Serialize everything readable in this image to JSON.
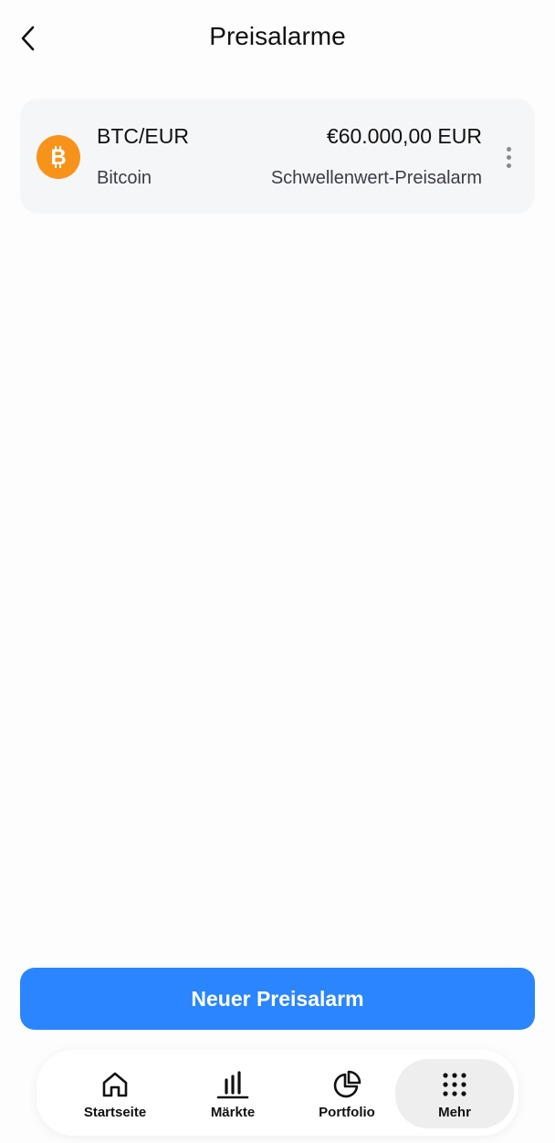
{
  "header": {
    "title": "Preisalarme",
    "back_icon": "chevron-left-icon"
  },
  "alarms": [
    {
      "pair": "BTC/EUR",
      "coin_name": "Bitcoin",
      "price": "€60.000,00 EUR",
      "type": "Schwellenwert-Preisalarm",
      "coin_color": "#f7931a",
      "icon": "bitcoin-icon",
      "more_icon": "more-vertical-icon"
    }
  ],
  "primary_button": {
    "label": "Neuer Preisalarm",
    "color": "#2a85ff"
  },
  "bottom_nav": {
    "items": [
      {
        "label": "Startseite",
        "icon": "home-icon",
        "active": false
      },
      {
        "label": "Märkte",
        "icon": "bar-chart-icon",
        "active": false
      },
      {
        "label": "Portfolio",
        "icon": "pie-chart-icon",
        "active": false
      },
      {
        "label": "Mehr",
        "icon": "grid-dots-icon",
        "active": true
      }
    ]
  }
}
